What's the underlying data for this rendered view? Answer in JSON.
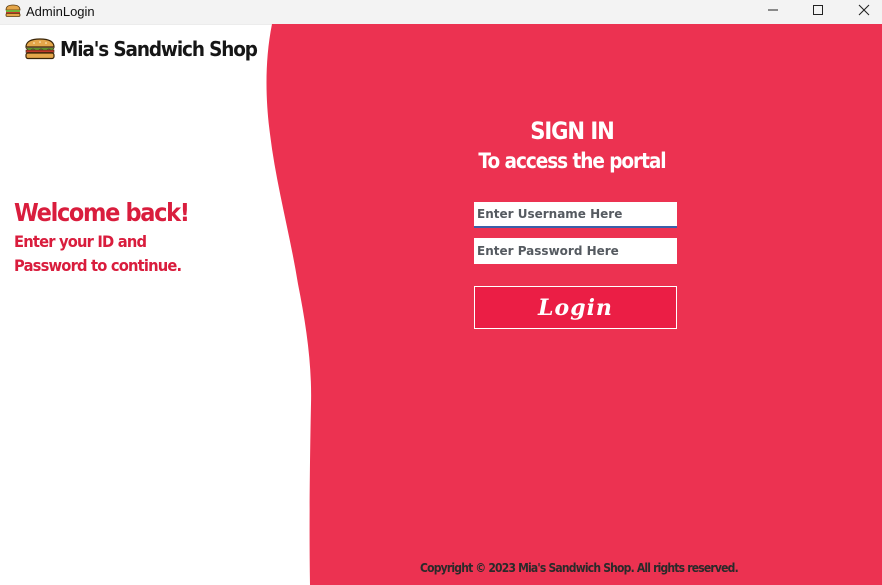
{
  "window": {
    "title": "AdminLogin",
    "icon": "sandwich-icon",
    "controls": [
      "minimize-icon",
      "maximize-icon",
      "close-icon"
    ]
  },
  "brand": {
    "name": "Mia's Sandwich Shop",
    "icon": "sandwich-icon"
  },
  "welcome": {
    "title": "Welcome back!",
    "subtitle_line1": "Enter your ID and",
    "subtitle_line2": "Password to continue."
  },
  "signin": {
    "title": "SIGN IN",
    "subtitle": "To access the portal",
    "username_placeholder": "Enter Username Here",
    "password_placeholder": "Enter Password Here",
    "login_label": "Login"
  },
  "footer": {
    "copyright": "Copyright © 2023 Mia's Sandwich Shop. All rights reserved."
  },
  "colors": {
    "accent": "#ec3251",
    "button": "#eb1e45",
    "welcome_text": "#d91d3d",
    "background": "#ffffff"
  }
}
